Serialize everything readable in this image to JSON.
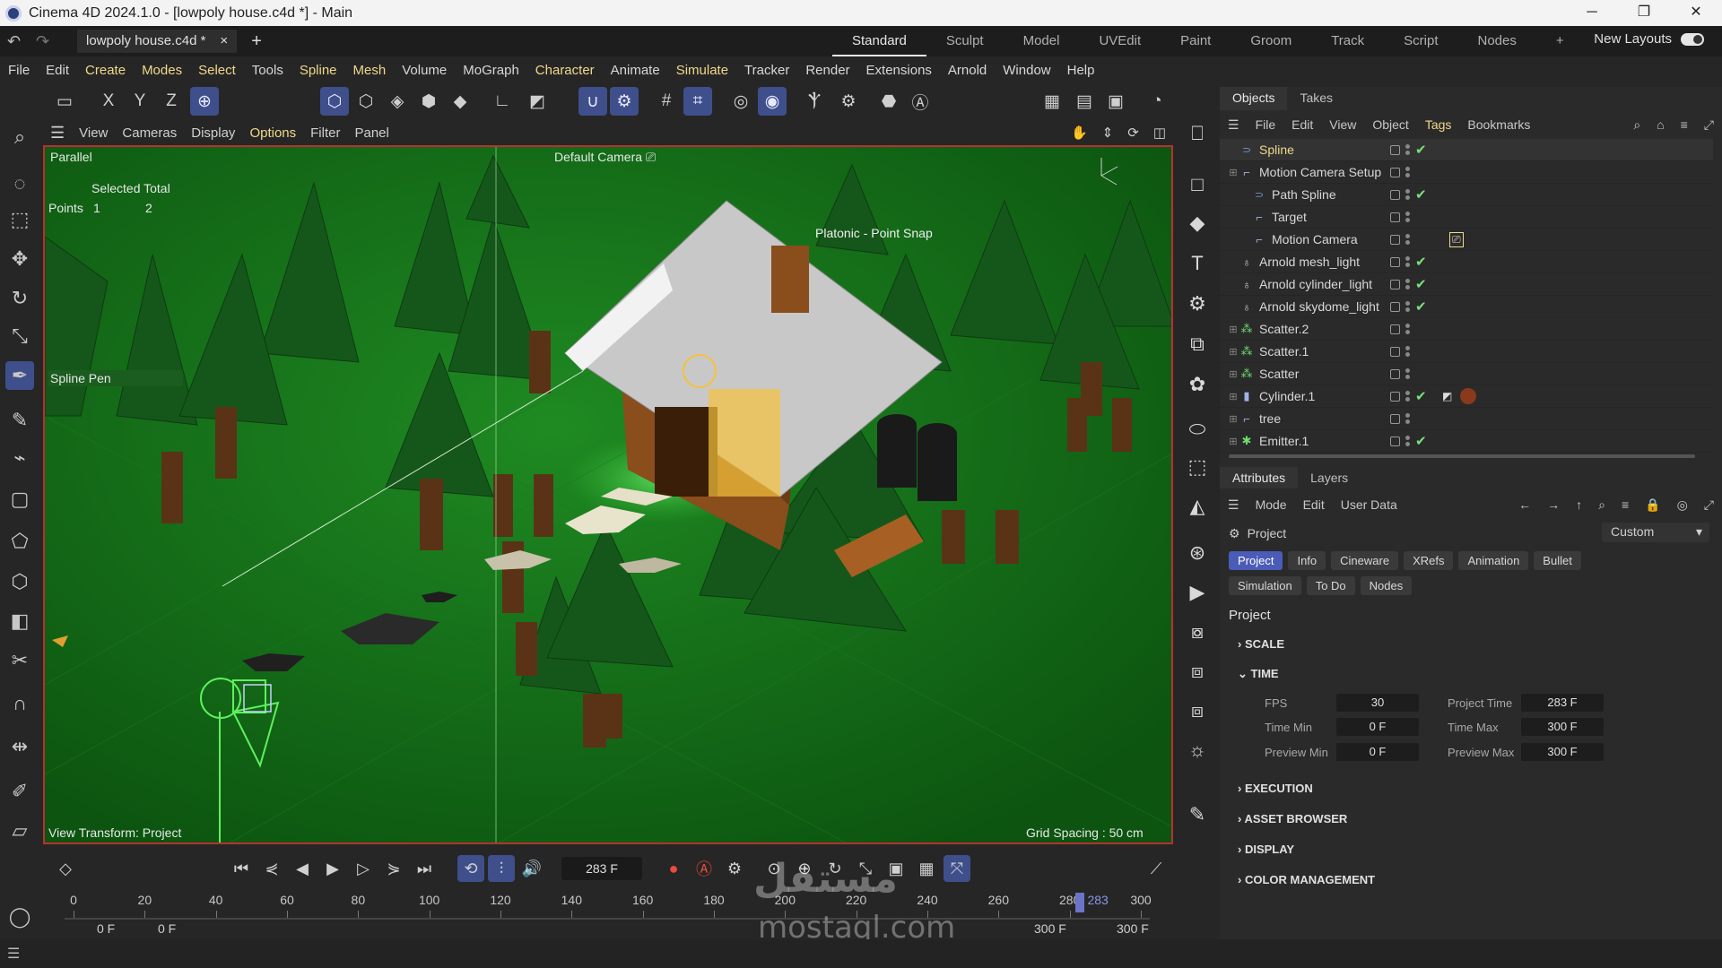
{
  "window": {
    "title": "Cinema 4D 2024.1.0 - [lowpoly house.c4d *] - Main"
  },
  "tabs": {
    "document": "lowpoly house.c4d *",
    "close": "×",
    "add": "+"
  },
  "layouts": [
    "Standard",
    "Sculpt",
    "Model",
    "UVEdit",
    "Paint",
    "Groom",
    "Track",
    "Script",
    "Nodes",
    "+"
  ],
  "new_layouts": "New Layouts",
  "menu": [
    "File",
    "Edit",
    "Create",
    "Modes",
    "Select",
    "Tools",
    "Spline",
    "Mesh",
    "Volume",
    "MoGraph",
    "Character",
    "Animate",
    "Simulate",
    "Tracker",
    "Render",
    "Extensions",
    "Arnold",
    "Window",
    "Help"
  ],
  "axis_buttons": [
    "X",
    "Y",
    "Z"
  ],
  "viewport": {
    "menu": [
      "View",
      "Cameras",
      "Display",
      "Options",
      "Filter",
      "Panel"
    ],
    "projection": "Parallel",
    "camera": "Default Camera",
    "stats_header": "Selected Total",
    "stats_label": "Points",
    "stats_selected": "1",
    "stats_total": "2",
    "tool": "Spline Pen",
    "snap_tip": "Platonic - Point Snap",
    "view_transform": "View Transform: Project",
    "grid_spacing": "Grid Spacing : 50 cm"
  },
  "objects_panel": {
    "tabs": [
      "Objects",
      "Takes"
    ],
    "menu": [
      "File",
      "Edit",
      "View",
      "Object",
      "Tags",
      "Bookmarks"
    ],
    "items": [
      {
        "name": "Spline",
        "icon": "spline-icon",
        "check": true,
        "selected": true
      },
      {
        "name": "Motion Camera Setup",
        "icon": "null-icon",
        "check": false
      },
      {
        "name": "Path Spline",
        "icon": "spline-icon",
        "check": true
      },
      {
        "name": "Target",
        "icon": "null-icon",
        "check": false
      },
      {
        "name": "Motion Camera",
        "icon": "camera-icon",
        "check": false
      },
      {
        "name": "Arnold mesh_light",
        "icon": "light-icon",
        "check": true
      },
      {
        "name": "Arnold cylinder_light",
        "icon": "light-icon",
        "check": true
      },
      {
        "name": "Arnold skydome_light",
        "icon": "light-icon",
        "check": true
      },
      {
        "name": "Scatter.2",
        "icon": "scatter-icon",
        "check": false
      },
      {
        "name": "Scatter.1",
        "icon": "scatter-icon",
        "check": false
      },
      {
        "name": "Scatter",
        "icon": "scatter-icon",
        "check": false
      },
      {
        "name": "Cylinder.1",
        "icon": "cylinder-icon",
        "check": true
      },
      {
        "name": "tree",
        "icon": "null-icon",
        "check": false
      },
      {
        "name": "Emitter.1",
        "icon": "emitter-icon",
        "check": true
      }
    ]
  },
  "attributes_panel": {
    "tabs": [
      "Attributes",
      "Layers"
    ],
    "menu": [
      "Mode",
      "Edit",
      "User Data"
    ],
    "object": "Project",
    "preset": "Custom",
    "buttons_row1": [
      "Project",
      "Info",
      "Cineware",
      "XRefs",
      "Animation",
      "Bullet"
    ],
    "buttons_row2": [
      "Simulation",
      "To Do",
      "Nodes"
    ],
    "section_title": "Project",
    "sections": [
      "SCALE",
      "TIME",
      "EXECUTION",
      "ASSET BROWSER",
      "DISPLAY",
      "COLOR MANAGEMENT"
    ],
    "time": {
      "fps_label": "FPS",
      "fps": "30",
      "project_time_label": "Project Time",
      "project_time": "283 F",
      "time_min_label": "Time Min",
      "time_min": "0 F",
      "time_max_label": "Time Max",
      "time_max": "300 F",
      "preview_min_label": "Preview Min",
      "preview_min": "0 F",
      "preview_max_label": "Preview Max",
      "preview_max": "300 F"
    }
  },
  "timeline": {
    "current_frame": "283 F",
    "ticks": [
      "0",
      "20",
      "40",
      "60",
      "80",
      "100",
      "120",
      "140",
      "160",
      "180",
      "200",
      "220",
      "240",
      "260",
      "280",
      "300"
    ],
    "playhead_label": "283",
    "start": "0 F",
    "preview_start": "0 F",
    "preview_end": "300 F",
    "end": "300 F",
    "playhead_fraction": 0.943
  },
  "watermark": {
    "logo": "مستقل",
    "url": "mostaql.com"
  },
  "colors": {
    "accent": "#3e4f8b",
    "viewport_bg": "#126a18",
    "selection": "#f1d88a",
    "viewport_border": "#b83030"
  }
}
